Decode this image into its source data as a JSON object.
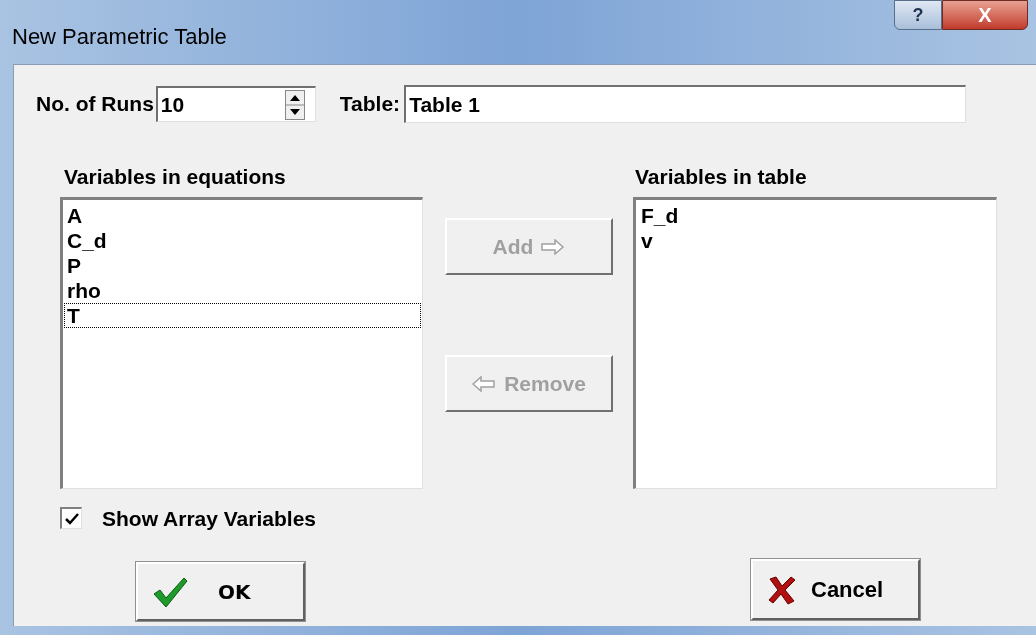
{
  "window": {
    "title": "New Parametric Table",
    "buttons": [
      {
        "kind": "help",
        "label": "?"
      },
      {
        "kind": "close",
        "label": "X"
      }
    ]
  },
  "runs": {
    "label": "No. of Runs",
    "value": "10"
  },
  "table": {
    "label": "Table:",
    "value": "Table 1"
  },
  "equations_list": {
    "label": "Variables in equations",
    "items": [
      {
        "text": "A",
        "focused": false
      },
      {
        "text": "C_d",
        "focused": false
      },
      {
        "text": "P",
        "focused": false
      },
      {
        "text": "rho",
        "focused": false
      },
      {
        "text": "T",
        "focused": true
      }
    ]
  },
  "add_button": {
    "label": "Add",
    "disabled": true
  },
  "remove_button": {
    "label": "Remove",
    "disabled": true
  },
  "table_list": {
    "label": "Variables in table",
    "items": [
      {
        "text": "F_d"
      },
      {
        "text": "v"
      }
    ]
  },
  "show_array": {
    "label": "Show Array Variables",
    "checked": true
  },
  "ok_button": {
    "label": "OK"
  },
  "cancel_button": {
    "label": "Cancel"
  }
}
